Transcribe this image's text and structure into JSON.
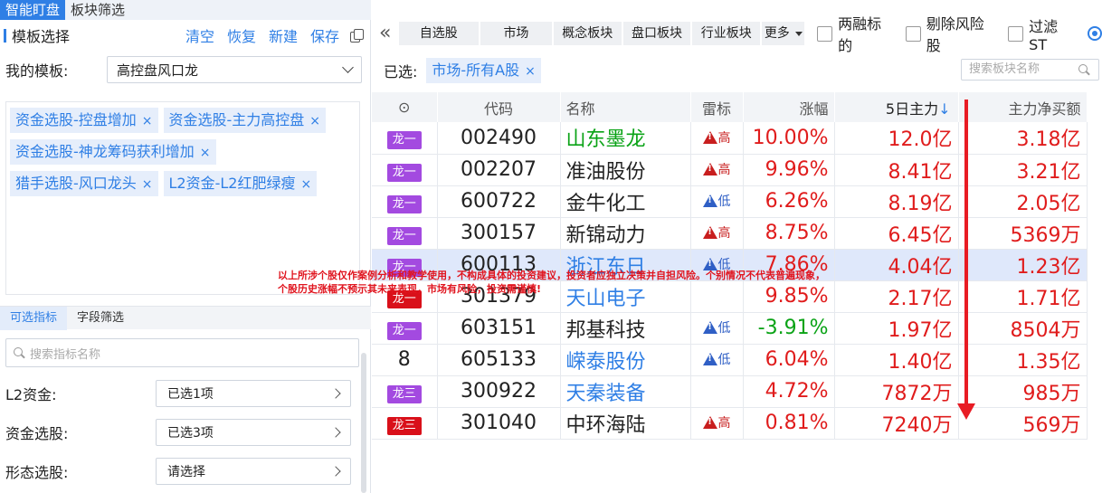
{
  "top_tabs": [
    "智能盯盘",
    "板块筛选"
  ],
  "left": {
    "title": "模板选择",
    "actions": [
      "清空",
      "恢复",
      "新建",
      "保存"
    ],
    "my_template_label": "我的模板:",
    "my_template_value": "高控盘风口龙",
    "tags": [
      "资金选股-控盘增加",
      "资金选股-主力高控盘",
      "资金选股-神龙筹码获利增加",
      "猎手选股-风口龙头",
      "L2资金-L2红肥绿瘦"
    ],
    "tag_close": "×",
    "sub_tabs": [
      "可选指标",
      "字段筛选"
    ],
    "indicator_search_placeholder": "搜索指标名称",
    "filters": [
      {
        "label": "L2资金:",
        "value": "已选1项"
      },
      {
        "label": "资金选股:",
        "value": "已选3项"
      },
      {
        "label": "形态选股:",
        "value": "请选择"
      }
    ]
  },
  "toolbar": {
    "buttons": [
      "自选股",
      "市场",
      "概念板块",
      "盘口板块",
      "行业板块"
    ],
    "more": "更多",
    "checkboxes": [
      "两融标的",
      "剔除风险股",
      "过滤ST"
    ]
  },
  "selected": {
    "label": "已选:",
    "tag": "市场-所有A股",
    "close": "×",
    "block_search_placeholder": "搜索板块名称"
  },
  "table": {
    "headers": [
      "代码",
      "名称",
      "雷标",
      "涨幅",
      "5日主力",
      "主力净买额"
    ],
    "sort_arrow": "↓",
    "rows": [
      {
        "badge": "龙一",
        "badge_color": "purple",
        "code": "002490",
        "name": "山东墨龙",
        "name_color": "green",
        "lei": "高",
        "change": "10.00%",
        "main5": "12.0亿",
        "net": "3.18亿"
      },
      {
        "badge": "龙一",
        "badge_color": "purple",
        "code": "002207",
        "name": "准油股份",
        "name_color": "black",
        "lei": "高",
        "change": "9.96%",
        "main5": "8.41亿",
        "net": "3.21亿"
      },
      {
        "badge": "龙一",
        "badge_color": "purple",
        "code": "600722",
        "name": "金牛化工",
        "name_color": "black",
        "lei": "低",
        "change": "6.26%",
        "main5": "8.19亿",
        "net": "2.05亿"
      },
      {
        "badge": "龙一",
        "badge_color": "purple",
        "code": "300157",
        "name": "新锦动力",
        "name_color": "black",
        "lei": "高",
        "change": "8.75%",
        "main5": "6.45亿",
        "net": "5369万"
      },
      {
        "badge": "龙一",
        "badge_color": "purple",
        "code": "600113",
        "name": "浙江东日",
        "name_color": "blue",
        "lei": "低",
        "change": "7.86%",
        "main5": "4.04亿",
        "net": "1.23亿",
        "highlight": true
      },
      {
        "badge": "龙一",
        "badge_color": "red",
        "code": "301379",
        "name": "天山电子",
        "name_color": "blue",
        "lei": "",
        "change": "9.85%",
        "main5": "2.17亿",
        "net": "1.71亿"
      },
      {
        "badge": "龙一",
        "badge_color": "purple",
        "code": "603151",
        "name": "邦基科技",
        "name_color": "black",
        "lei": "低",
        "change": "-3.91%",
        "main5": "1.97亿",
        "net": "8504万"
      },
      {
        "badge": "8",
        "badge_color": "none",
        "code": "605133",
        "name": "嵘泰股份",
        "name_color": "blue",
        "lei": "低",
        "change": "6.04%",
        "main5": "1.40亿",
        "net": "1.35亿"
      },
      {
        "badge": "龙三",
        "badge_color": "purple",
        "code": "300922",
        "name": "天秦装备",
        "name_color": "blue",
        "lei": "",
        "change": "4.72%",
        "main5": "7872万",
        "net": "985万"
      },
      {
        "badge": "龙三",
        "badge_color": "red",
        "code": "301040",
        "name": "中环海陆",
        "name_color": "black",
        "lei": "高",
        "change": "0.81%",
        "main5": "7240万",
        "net": "569万"
      }
    ]
  },
  "disclaimer": [
    "以上所涉个股仅作案例分析和教学使用，不构成具体的投资建议，投资者应独立决策并自担风险。个别情况不代表普遍现象，",
    "个股历史涨幅不预示其未来表现，市场有风险，投资需谨慎!"
  ],
  "colors": {
    "accent": "#2f7fe5",
    "up": "#e01c1c",
    "down": "#0aa316",
    "badge_purple": "#a34ae0",
    "badge_red": "#d9101a"
  }
}
